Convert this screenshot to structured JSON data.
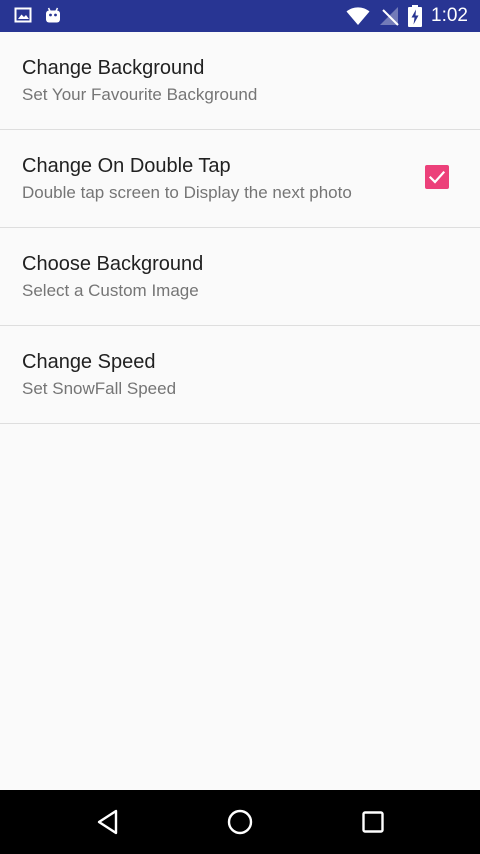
{
  "status_bar": {
    "time": "1:02",
    "left_icons": [
      "image-icon",
      "android-icon"
    ],
    "right_icons": [
      "wifi-icon",
      "no-signal-icon",
      "battery-charging-icon"
    ],
    "background_color": "#283593"
  },
  "settings": [
    {
      "title": "Change Background",
      "summary": "Set Your Favourite Background"
    },
    {
      "title": "Change On Double Tap",
      "summary": "Double tap screen to Display the next photo",
      "checked": true
    },
    {
      "title": "Choose Background",
      "summary": "Select a Custom Image"
    },
    {
      "title": "Change Speed",
      "summary": "Set SnowFall Speed"
    }
  ],
  "nav_bar": {
    "buttons": [
      "back-icon",
      "home-icon",
      "recents-icon"
    ]
  },
  "colors": {
    "accent": "#ec407a",
    "status_bar": "#283593",
    "background": "#fafafa"
  }
}
